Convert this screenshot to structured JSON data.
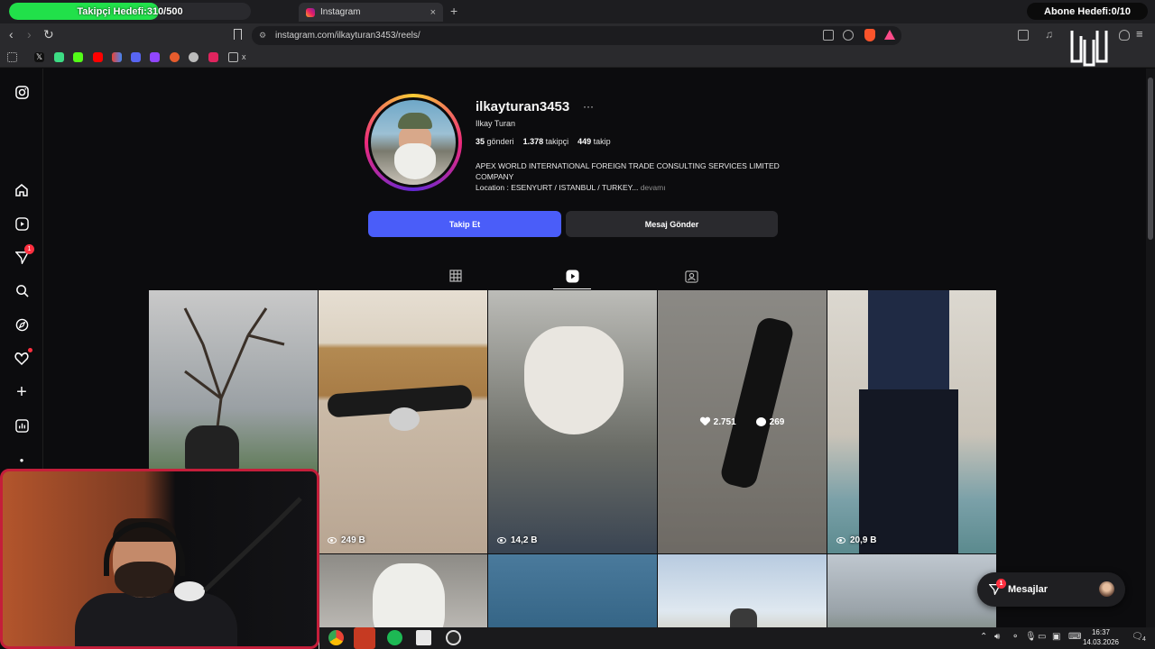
{
  "overlay": {
    "follower_goal": "Takipçi Hedefi:310/500",
    "follower_goal_progress": 0.62,
    "subscriber_goal": "Abone Hedefi:0/10"
  },
  "browser": {
    "tab_title": "Instagram",
    "tab_close": "×",
    "new_tab": "+",
    "url": "instagram.com/ilkayturan3453/reels/",
    "bookmarks_overflow": "x"
  },
  "profile": {
    "username": "ilkayturan3453",
    "more": "···",
    "full_name": "Ilkay Turan",
    "posts_count": "35",
    "posts_label": "gönderi",
    "followers_count": "1.378",
    "followers_label": "takipçi",
    "following_count": "449",
    "following_label": "takip",
    "bio_line1": "APEX WORLD INTERNATIONAL FOREIGN TRADE CONSULTING SERVICES LIMITED COMPANY",
    "bio_line2": "Location : ESENYURT / ISTANBUL / TURKEY...",
    "bio_more": "devamı",
    "follow_button": "Takip Et",
    "message_button": "Mesaj Gönder"
  },
  "tabs": {
    "active": "reels",
    "items": [
      "posts",
      "reels",
      "tagged"
    ]
  },
  "sidebar": {
    "notifications_badge": "1",
    "items": [
      "instagram-logo",
      "home",
      "reels",
      "direct",
      "search",
      "explore",
      "notifications",
      "create",
      "dashboard",
      "more"
    ]
  },
  "reels": [
    {
      "views": ""
    },
    {
      "views": "249 B"
    },
    {
      "views": "14,2 B"
    },
    {
      "likes": "2.751",
      "comments": "269"
    },
    {
      "views": "20,9 B"
    }
  ],
  "messages": {
    "label": "Mesajlar",
    "badge": "1"
  },
  "taskbar": {
    "time": "16:37",
    "date": "14.03.2026",
    "notifications": "4"
  },
  "colors": {
    "follow_button": "#4a5df9",
    "goal_fill": "#21e04a",
    "webcam_border": "#c41e3a",
    "badge": "#ff3040"
  }
}
